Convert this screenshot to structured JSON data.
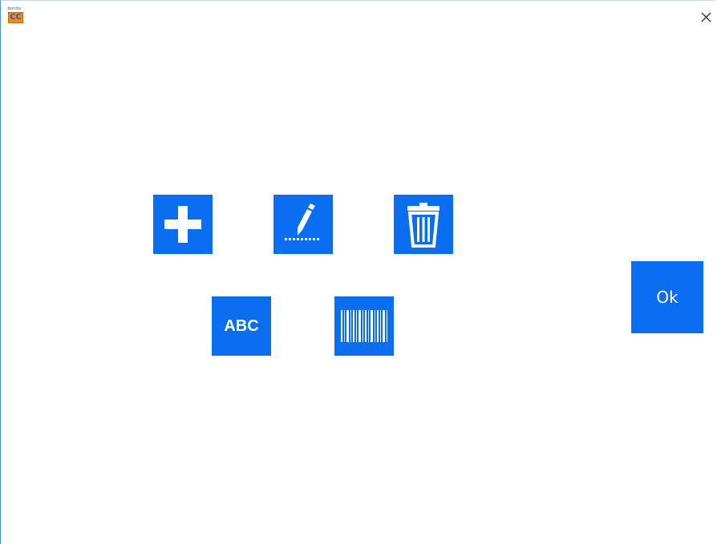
{
  "window": {
    "app_icon": "app-logo-icon",
    "app_logo_top_text": "bonita",
    "app_logo_text": "CC",
    "close_icon": "close-icon"
  },
  "toolbar": {
    "add_icon": "plus-icon",
    "edit_icon": "pencil-icon",
    "delete_icon": "trash-icon",
    "text_label": "ABC",
    "barcode_icon": "barcode-icon"
  },
  "ok_button": {
    "label": "Ok"
  },
  "colors": {
    "tile": "#0a6ef0",
    "icon": "#ffffff",
    "background": "#ffffff"
  }
}
